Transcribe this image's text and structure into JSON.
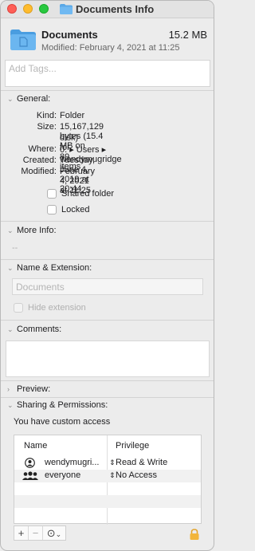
{
  "window": {
    "title": "Documents Info"
  },
  "header": {
    "name": "Documents",
    "size": "15.2 MB",
    "modified": "Modified: February 4, 2021 at 11:25"
  },
  "tags": {
    "placeholder": "Add Tags..."
  },
  "general": {
    "title": "General:",
    "kind_label": "Kind:",
    "kind_value": "Folder",
    "size_label": "Size:",
    "size_value_1": "15,167,129 bytes (15.4 MB on",
    "size_value_2": "disk) for 89 items",
    "where_label": "Where:",
    "where_value": "0. ▸ Users ▸ wendymugridge",
    "created_label": "Created:",
    "created_value": "Tuesday, June 4, 2019 at 20:44",
    "modified_label": "Modified:",
    "modified_value": "February 4, 2021 at 11:25",
    "shared_folder": "Shared folder",
    "locked": "Locked"
  },
  "more_info": {
    "title": "More Info:",
    "value": "--"
  },
  "name_ext": {
    "title": "Name & Extension:",
    "name_value": "Documents",
    "hide_extension": "Hide extension"
  },
  "comments": {
    "title": "Comments:"
  },
  "preview": {
    "title": "Preview:"
  },
  "sharing": {
    "title": "Sharing & Permissions:",
    "access": "You have custom access",
    "col_name": "Name",
    "col_privilege": "Privilege",
    "rows": [
      {
        "name": "wendymugri...",
        "privilege": "Read & Write",
        "icon": "user-icon"
      },
      {
        "name": "everyone",
        "privilege": "No Access",
        "icon": "group-icon"
      }
    ]
  },
  "toolbar": {
    "add": "+",
    "remove": "−",
    "more": "⊙",
    "more_caret": "⌄"
  }
}
